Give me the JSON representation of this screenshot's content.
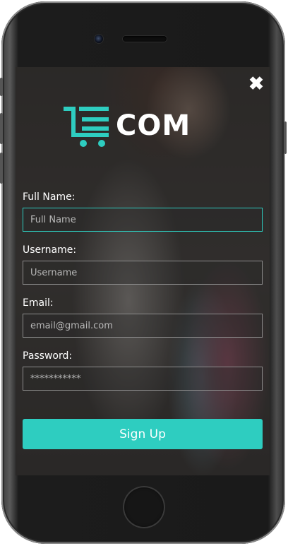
{
  "app": {
    "logo_text": "COM",
    "close_icon": "close-icon",
    "accent_color": "#2ecdc0"
  },
  "form": {
    "fullname": {
      "label": "Full Name:",
      "placeholder": "Full Name",
      "value": ""
    },
    "username": {
      "label": "Username:",
      "placeholder": "Username",
      "value": ""
    },
    "email": {
      "label": "Email:",
      "placeholder": "email@gmail.com",
      "value": ""
    },
    "password": {
      "label": "Password:",
      "placeholder": "***********",
      "value": ""
    },
    "submit_label": "Sign Up"
  }
}
